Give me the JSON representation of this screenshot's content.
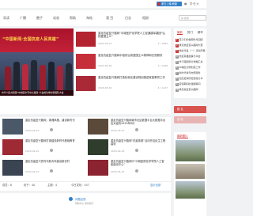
{
  "topbar": {
    "user_label": "孝白 | 晚 刷新",
    "bell_icon": "bell-icon",
    "side_text": "学·在·大"
  },
  "nav": {
    "items": [
      "导读",
      "广播",
      "圈子",
      "动态",
      "帮助",
      "淘帖",
      "我 目",
      "日志",
      "相册"
    ],
    "search_placeholder": "请 搜索"
  },
  "banner": {
    "title": "“中国新闻·全国抗疫人民英雄”",
    "caption": "中华人民共和国“中城区中有中兴发展”大会成功举办暨国际大会"
  },
  "news": [
    {
      "title": "重走抗疫复兴路网“中城医护化学院人工促通建军建团“弘扬爱国主义”",
      "date": "2020-05-27",
      "views": "3 / 1580"
    },
    {
      "title": "重走抗疫复兴路网中组织弘扬爱国主义精神和志愿服务",
      "date": "2020-05-26",
      "views": "3 / 1298"
    },
    {
      "title": "重走抗疫复兴路网打造标准化建设规划推进家庭教育工作",
      "date": "2020-05-16",
      "views": "4 / 1127"
    }
  ],
  "articles": [
    {
      "title": "重走抗疫复兴路网，湖湘风格，建设新时代",
      "date": "2020-04-23"
    },
    {
      "title": "重走抗疫复兴路网城市社区数据平台大数据平台应对疫情2020年8月",
      "date": "2020-05-07"
    },
    {
      "title": "重走抗疫复兴路网打造建设新时代基础教育",
      "date": "2020-04-21"
    },
    {
      "title": "重走抗疫复兴路网“抗疫英雄”活动开启民生工程建设",
      "date": "2020-04-23"
    },
    {
      "title": "重走抗疫复兴的时代新青年建设新农村",
      "date": "2020-04-21"
    },
    {
      "title": "重走抗疫复兴路网中“中城医院化学学院人工智能建设中心”",
      "date": "2020-05-23"
    }
  ],
  "stats": {
    "members": "成员：8",
    "posts": "帖子：40",
    "replies": "主题：4",
    "today": "今日发帖：457",
    "more": "显示全部"
  },
  "footer": {
    "title": "问题反馈",
    "subtitle": "帮助中心 联系我们"
  },
  "side": {
    "tabs": [
      "最新",
      "热门",
      "精华"
    ],
    "list": [
      "孩子们的暑假时光回顾",
      "重走抗疫复兴路网大赛",
      "精彩纷呈（一）活动开展",
      "抗疫英雄故事分享会",
      "学习强国积分攻略汇总",
      "中城区文明创建工作",
      "新时代青年志愿服务",
      "社区疫情防控经验分享",
      "疫情期间的温暖瞬间",
      "重走抗疫复兴路网"
    ],
    "btn_signup": "报 名",
    "btn_post": "发 帖",
    "gallery_title": "最新图片"
  },
  "colors": {
    "accent": "#c33333",
    "blue": "#2f7fc9"
  }
}
